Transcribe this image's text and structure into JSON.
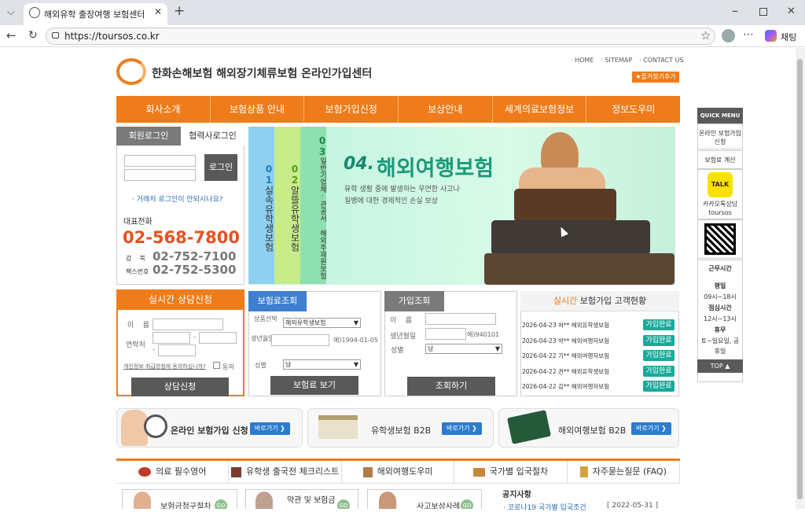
{
  "browser": {
    "tab_title": "해외유학 출장여행 보험센터",
    "url": "https://toursos.co.kr",
    "chat_label": "채팅"
  },
  "header": {
    "logo_text": "한화손해보험 해외장기체류보험 온라인가입센터",
    "top_links": [
      "· HOME",
      "· SITEMAP",
      "· CONTACT US"
    ],
    "bookmark": "★즐겨찾기추가"
  },
  "nav": [
    "회사소개",
    "보험상품 안내",
    "보험가입신청",
    "보상안내",
    "세계의료보험정보",
    "정보도우미"
  ],
  "login": {
    "tab_member": "회원로그인",
    "tab_partner": "협력사로그인",
    "button": "로그인",
    "help": "· 거래처 로그인이 안되시나요?",
    "phone_title": "대표전화",
    "main_phone": "02-568-7800",
    "sub1_label": "강    북",
    "sub1": "02-752-7100",
    "sub2_label": "팩스번호",
    "sub2": "02-752-5300"
  },
  "hero": {
    "tabs": [
      {
        "num": "01",
        "text": "실속유학생보험"
      },
      {
        "num": "02",
        "text": "알뜰유학생보험"
      },
      {
        "num": "03",
        "text": "일반기업체·관공서 해외주재원보험"
      }
    ],
    "title_num": "04.",
    "title": "해외여행보험",
    "desc1": "유학 생활 중에 발생하는 우연한 사고나",
    "desc2": "질병에 대한 경제적인 손실 보상"
  },
  "consult": {
    "title": "실시간 상담신청",
    "name_label": "이    름",
    "contact_label": "연락처",
    "privacy": "개인정보 취급방침에 동의하십니까?",
    "agree": "동의",
    "button": "상담신청"
  },
  "premium": {
    "tab": "보험료조회",
    "product_label": "상품선택",
    "product_value": "해외유학생보험",
    "birth_label": "생년월일",
    "birth_hint": "예)1994-01-05",
    "gender_label": "성별",
    "gender_value": "남",
    "button": "보험료 보기"
  },
  "join": {
    "tab": "가입조회",
    "name_label": "이    름",
    "birth_label": "생년월일",
    "birth_hint": "예)940101",
    "gender_label": "성별",
    "gender_value": "남",
    "button": "조회하기"
  },
  "status": {
    "title_em": "실시간",
    "title": " 보험가입 고객현황",
    "rows": [
      {
        "text": "2026-04-23 허** 해외유학생보험",
        "badge": "가입완료"
      },
      {
        "text": "2026-04-23 박** 해외여행자보험",
        "badge": "가입완료"
      },
      {
        "text": "2026-04-22 기** 해외여행자보험",
        "badge": "가입완료"
      },
      {
        "text": "2026-04-22 권** 해외유학생보험",
        "badge": "가입완료"
      },
      {
        "text": "2026-04-22 김** 해외여행자보험",
        "badge": "가입완료"
      }
    ]
  },
  "quick": {
    "title": "QUICK MENU",
    "item1": "온라인 보험가입신청",
    "item2": "보험료 계산",
    "kakao": "TALK",
    "kakao_label": "카카오톡상담 toursos",
    "hours_title": "근무시간",
    "weekday": "평일",
    "weekday_time": "09시~18시",
    "lunch": "점심시간",
    "lunch_time": "12시~13시",
    "holiday": "휴무",
    "holiday_time": "토~일요일, 공휴일",
    "top": "TOP ▲"
  },
  "banners": [
    {
      "title": "온라인 보험가입 신청",
      "go": "바로가기 ❯"
    },
    {
      "title": "유학생보험 B2B",
      "go": "바로가기 ❯"
    },
    {
      "title": "해외여행보험 B2B",
      "go": "바로가기 ❯"
    }
  ],
  "bottom_tabs": [
    "의료 필수영어",
    "유학생 출국전 체크리스트",
    "해외여행도우미",
    "국가별 입국절차",
    "자주묻는질문 (FAQ)"
  ],
  "bottom": {
    "card1": "보험금청구절차",
    "card2": "약관 및 보험금",
    "card3": "사고보상사례",
    "go": "GO",
    "notice_title": "공지사항",
    "notice_item": "· 코로나19 국가별 입국조건",
    "notice_date": "[ 2022-05-31 ]"
  }
}
